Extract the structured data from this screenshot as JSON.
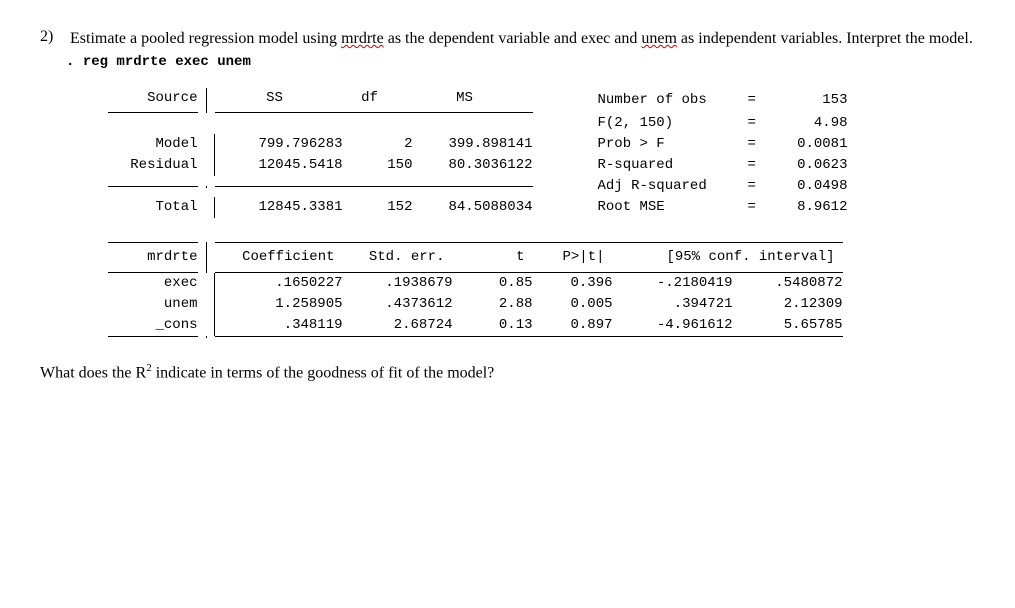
{
  "question": {
    "number": "2)",
    "text_parts": {
      "p1": "Estimate a pooled regression model using ",
      "v1": "mrdrte",
      "p2": " as the dependent variable and exec and ",
      "v2": "unem",
      "p3": " as independent variables. Interpret the model."
    }
  },
  "command": {
    "dot": ".",
    "text": "reg mrdrte exec unem"
  },
  "anova": {
    "headers": {
      "source": "Source",
      "ss": "SS",
      "df": "df",
      "ms": "MS"
    },
    "rows": [
      {
        "label": "Model",
        "ss": "799.796283",
        "df": "2",
        "ms": "399.898141"
      },
      {
        "label": "Residual",
        "ss": "12045.5418",
        "df": "150",
        "ms": "80.3036122"
      }
    ],
    "total": {
      "label": "Total",
      "ss": "12845.3381",
      "df": "152",
      "ms": "84.5088034"
    }
  },
  "stats": [
    {
      "label": "Number of obs",
      "eq": "=",
      "val": "153"
    },
    {
      "label": "F(2, 150)",
      "eq": "=",
      "val": "4.98"
    },
    {
      "label": "Prob > F",
      "eq": "=",
      "val": "0.0081"
    },
    {
      "label": "R-squared",
      "eq": "=",
      "val": "0.0623"
    },
    {
      "label": "Adj R-squared",
      "eq": "=",
      "val": "0.0498"
    },
    {
      "label": "Root MSE",
      "eq": "=",
      "val": "8.9612"
    }
  ],
  "coef": {
    "headers": {
      "depvar": "mrdrte",
      "coef": "Coefficient",
      "se": "Std. err.",
      "t": "t",
      "p": "P>|t|",
      "ci": "[95% conf. interval]"
    },
    "rows": [
      {
        "var": "exec",
        "coef": ".1650227",
        "se": ".1938679",
        "t": "0.85",
        "p": "0.396",
        "lo": "-.2180419",
        "hi": ".5480872"
      },
      {
        "var": "unem",
        "coef": "1.258905",
        "se": ".4373612",
        "t": "2.88",
        "p": "0.005",
        "lo": ".394721",
        "hi": "2.12309"
      },
      {
        "var": "_cons",
        "coef": ".348119",
        "se": "2.68724",
        "t": "0.13",
        "p": "0.897",
        "lo": "-4.961612",
        "hi": "5.65785"
      }
    ]
  },
  "followup": {
    "p1": "What does the R",
    "sup": "2",
    "p2": " indicate in terms of the goodness of fit of the model?"
  }
}
